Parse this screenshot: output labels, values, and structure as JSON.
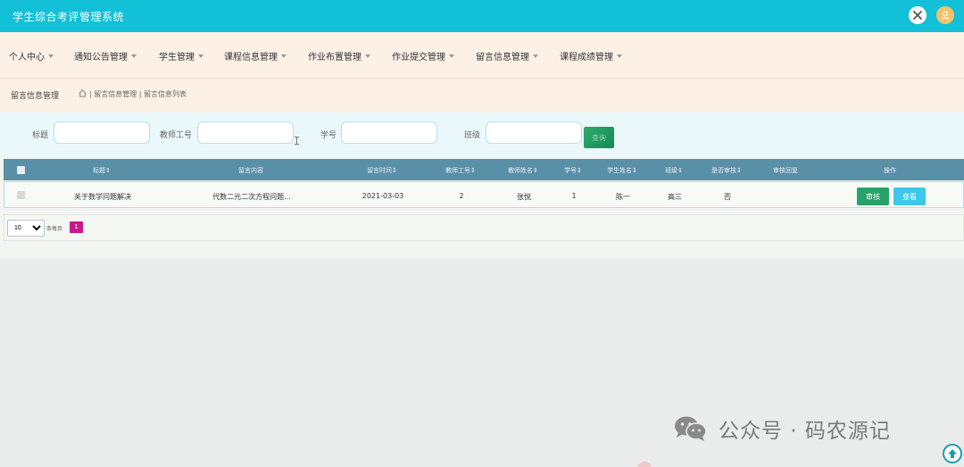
{
  "header": {
    "title": "学生综合考评管理系统"
  },
  "nav": {
    "items": [
      {
        "label": "个人中心"
      },
      {
        "label": "通知公告管理"
      },
      {
        "label": "学生管理"
      },
      {
        "label": "课程信息管理"
      },
      {
        "label": "作业布置管理"
      },
      {
        "label": "作业提交管理"
      },
      {
        "label": "留言信息管理"
      },
      {
        "label": "课程成绩管理"
      }
    ]
  },
  "breadcrumb": {
    "title": "留言信息管理",
    "path": "| 留言信息管理 | 留言信息列表"
  },
  "filters": {
    "title_label": "标题",
    "teacher_id_label": "教师工号",
    "student_id_label": "学号",
    "class_label": "班级",
    "search_label": "查询"
  },
  "table": {
    "headers": [
      "标题⇕",
      "留言内容",
      "留言时间⇕",
      "教师工号⇕",
      "教师姓名⇕",
      "学号⇕",
      "学生姓名⇕",
      "班级⇕",
      "是否审核⇕",
      "审核回复",
      "操作"
    ],
    "rows": [
      {
        "title": "关于数学问题解决",
        "content": "代数二元二次方程问题...",
        "time": "2021-03-03",
        "teacher_id": "2",
        "teacher_name": "张悦",
        "student_id": "1",
        "student_name": "陈一",
        "class": "高三",
        "reviewed": "否",
        "reply": "",
        "review_label": "审核",
        "view_label": "查看"
      }
    ]
  },
  "pagination": {
    "page_size": "10",
    "per_page_label": "条每页",
    "current_page": "1"
  },
  "watermark": {
    "text": "公众号 · 码农源记"
  },
  "colors": {
    "topbar": "#12c0d8",
    "nav_bg": "#fdf1e6",
    "table_header": "#5a8fa8",
    "review_button": "#26a36a",
    "view_button": "#3cc8ea",
    "page_active": "#c9188b"
  }
}
